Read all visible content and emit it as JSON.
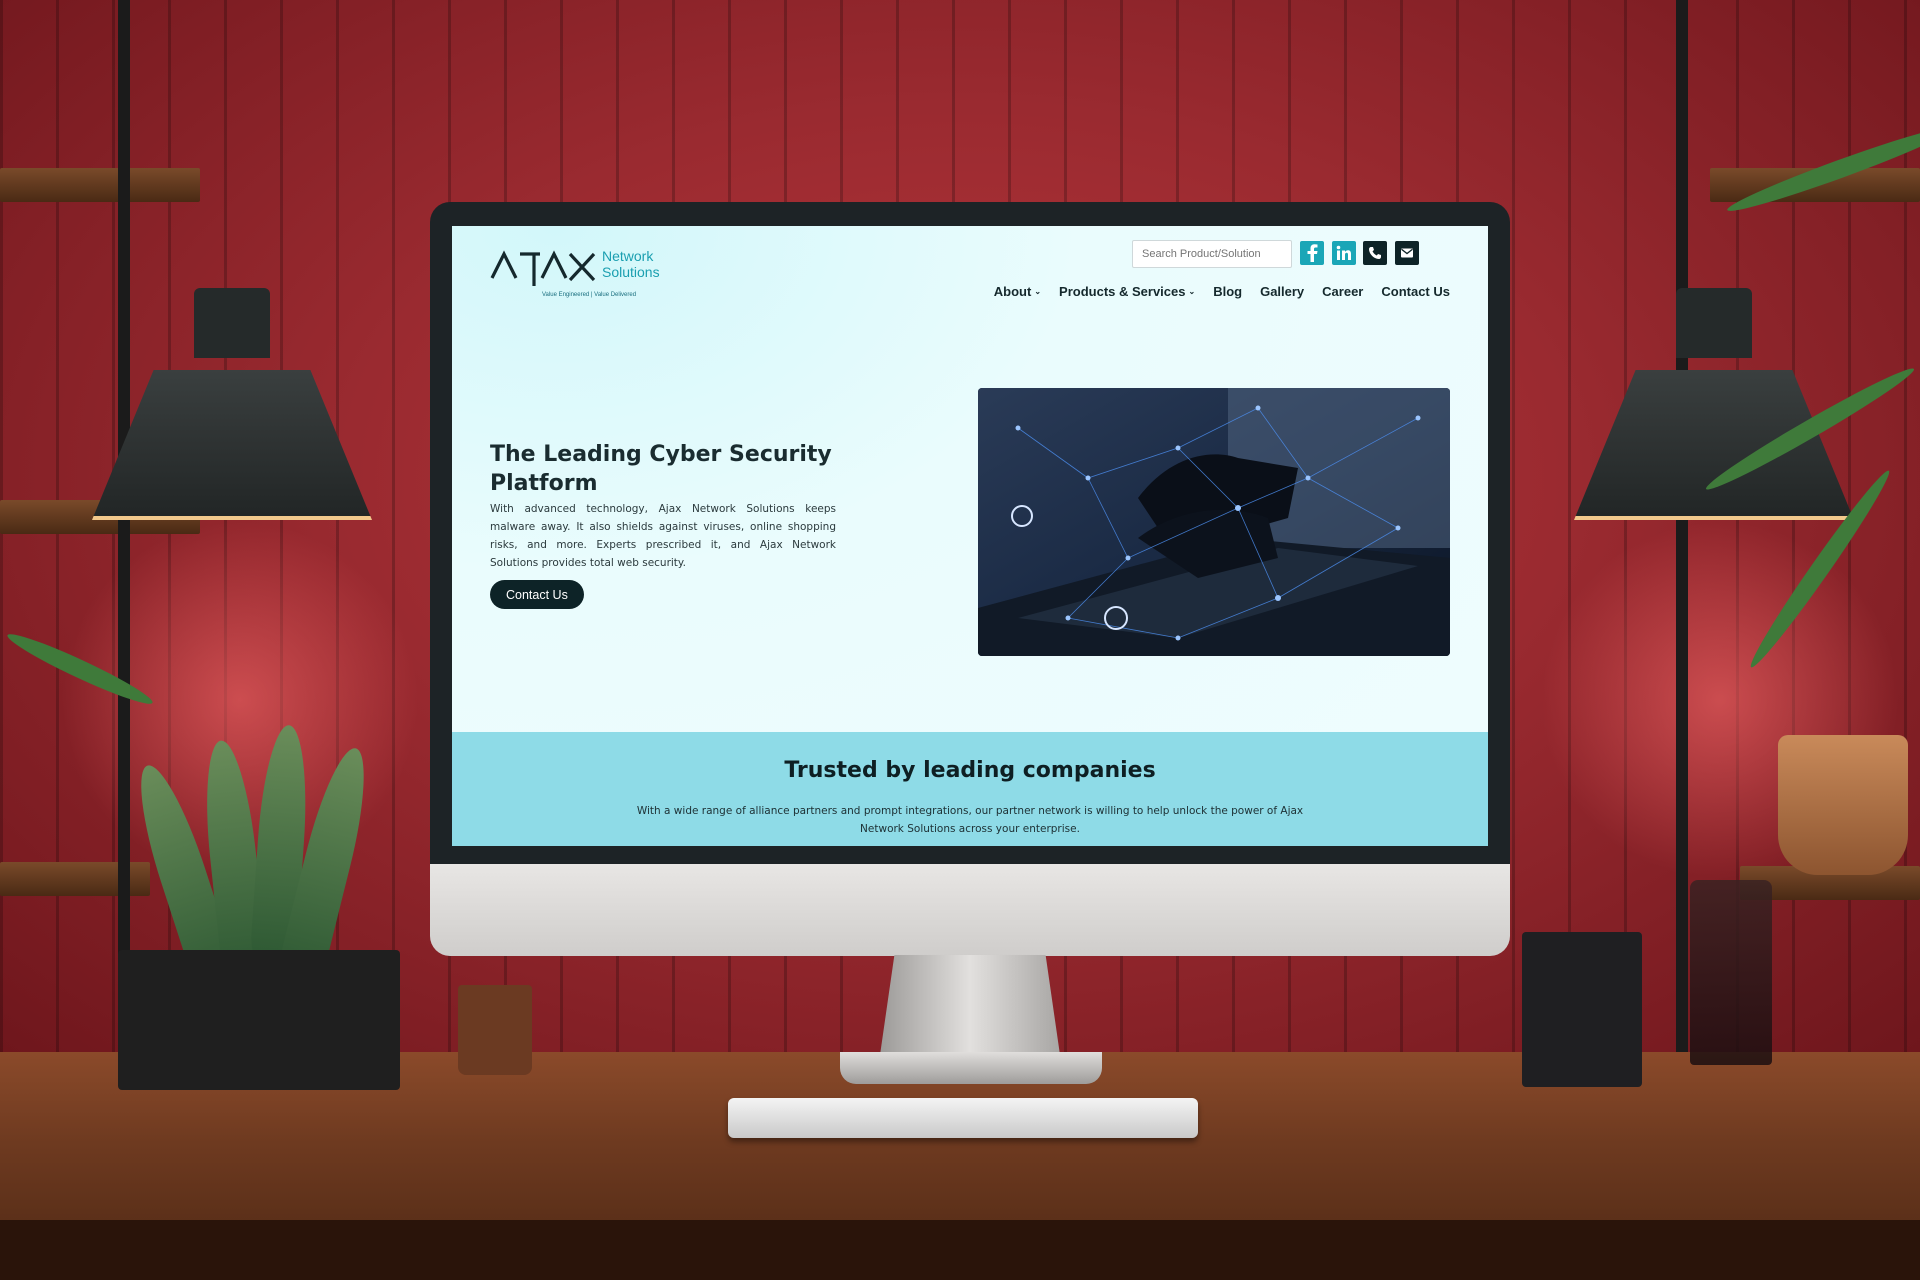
{
  "site": {
    "logo": {
      "mark": "AJAX",
      "line1": "Network",
      "line2": "Solutions",
      "tagline": "Value Engineered  |  Value Delivered"
    },
    "search": {
      "placeholder": "Search Product/Solution"
    },
    "social": [
      {
        "icon": "facebook-icon",
        "label": "f"
      },
      {
        "icon": "linkedin-icon",
        "label": "in"
      },
      {
        "icon": "phone-icon"
      },
      {
        "icon": "mail-icon"
      }
    ],
    "nav": [
      {
        "label": "About",
        "dropdown": true
      },
      {
        "label": "Products & Services",
        "dropdown": true
      },
      {
        "label": "Blog",
        "dropdown": false
      },
      {
        "label": "Gallery",
        "dropdown": false
      },
      {
        "label": "Career",
        "dropdown": false
      },
      {
        "label": "Contact Us",
        "dropdown": false
      }
    ],
    "caret": "⌄",
    "hero": {
      "title": "The Leading Cyber Security Platform",
      "text": "With advanced technology, Ajax Network Solutions keeps malware away. It also shields against viruses, online shopping risks, and more. Experts prescribed  it, and Ajax Network Solutions provides total web security.",
      "button": "Contact Us"
    },
    "trusted": {
      "title": "Trusted by leading companies",
      "text": "With a wide range of alliance partners and prompt integrations, our partner network is willing to help unlock the power of Ajax Network Solutions across your enterprise."
    },
    "colors": {
      "accent": "#1aa6b7",
      "dark": "#0d2327",
      "band": "#8edbe7",
      "wall": "#a8303a"
    }
  }
}
